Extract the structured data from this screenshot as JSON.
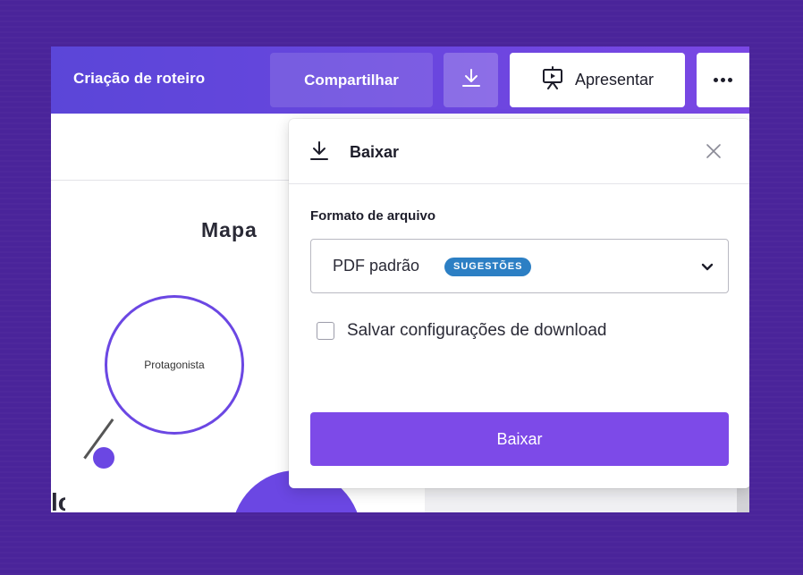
{
  "app": {
    "doc_title": "Criação de roteiro"
  },
  "toolbar": {
    "share_label": "Compartilhar",
    "download_icon": "download-icon",
    "present_label": "Apresentar",
    "present_icon": "presentation-icon",
    "more_icon": "more-dots-icon"
  },
  "canvas": {
    "slide_title": "Mapa",
    "node_label": "Protagonista",
    "partial_text": "lo"
  },
  "download_panel": {
    "title": "Baixar",
    "format_label": "Formato de arquivo",
    "format_value": "PDF padrão",
    "format_badge": "SUGESTÕES",
    "save_settings_label": "Salvar configurações de download",
    "save_settings_checked": false,
    "download_button": "Baixar"
  },
  "colors": {
    "background": "#4a249a",
    "topbar_start": "#5b46d8",
    "accent": "#7d4ae8",
    "badge": "#2c7fc4"
  }
}
